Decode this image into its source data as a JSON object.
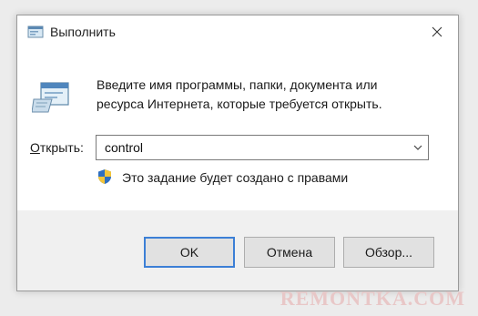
{
  "window": {
    "title": "Выполнить"
  },
  "body": {
    "description": "Введите имя программы, папки, документа или ресурса Интернета, которые требуется открыть.",
    "open_label_accel": "О",
    "open_label_rest": "ткрыть:",
    "open_value": "control",
    "admin_note": "Это задание будет создано с правами"
  },
  "buttons": {
    "ok": "OK",
    "cancel": "Отмена",
    "browse": "Обзор..."
  },
  "watermark": "REMONTKA.COM",
  "icons": {
    "title": "run-app-icon",
    "main": "run-program-icon",
    "close": "close-icon",
    "dropdown": "chevron-down-icon",
    "shield": "uac-shield-icon"
  },
  "colors": {
    "accent_border": "#3c7fd6",
    "footer_bg": "#f0f0f0",
    "watermark": "#e8c7c7"
  }
}
